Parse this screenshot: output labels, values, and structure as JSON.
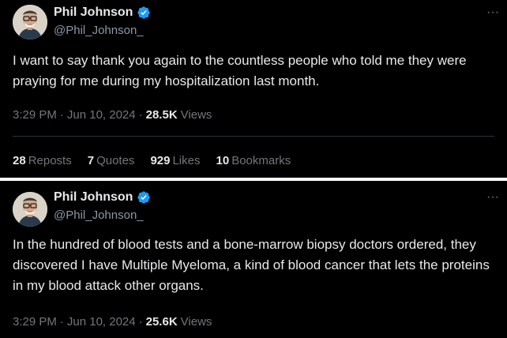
{
  "tweets": [
    {
      "author": {
        "name": "Phil Johnson",
        "handle": "@Phil_Johnson_"
      },
      "text": "I want to say thank you again to the countless people who told me they were praying for me during my hospitalization last month.",
      "time": "3:29 PM",
      "date": "Jun 10, 2024",
      "views_count": "28.5K",
      "views_label": "Views",
      "stats": [
        {
          "count": "28",
          "label": "Reposts"
        },
        {
          "count": "7",
          "label": "Quotes"
        },
        {
          "count": "929",
          "label": "Likes"
        },
        {
          "count": "10",
          "label": "Bookmarks"
        }
      ]
    },
    {
      "author": {
        "name": "Phil Johnson",
        "handle": "@Phil_Johnson_"
      },
      "text": "In the hundred of blood tests and a bone-marrow biopsy doctors ordered, they discovered I have Multiple Myeloma, a kind of blood cancer that lets the proteins in my blood attack other organs.",
      "time": "3:29 PM",
      "date": "Jun 10, 2024",
      "views_count": "25.6K",
      "views_label": "Views"
    }
  ],
  "ui": {
    "more_glyph": "···",
    "dot": "·",
    "verified_color": "#1d9bf0"
  }
}
